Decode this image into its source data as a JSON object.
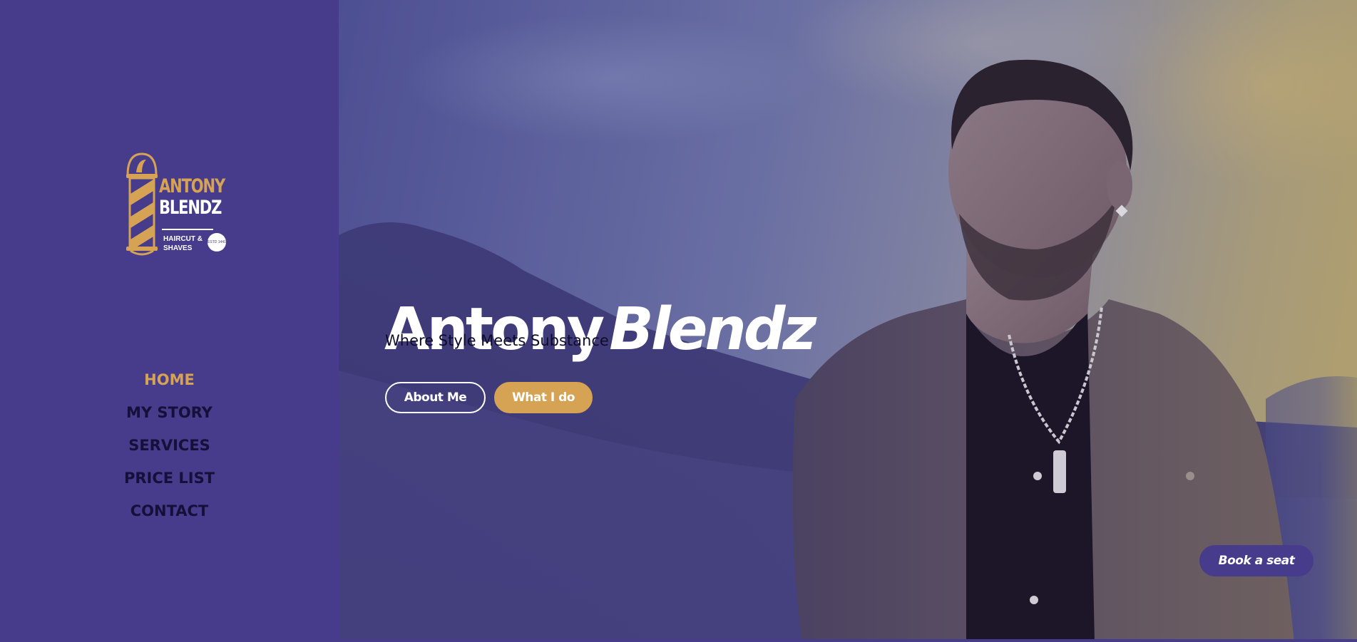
{
  "brand": {
    "name_line1": "ANTONY",
    "name_line2": "BLENDZ",
    "subtitle": "HAIRCUT & SHAVES",
    "badge": "ESTD 1441",
    "colors": {
      "primary": "#473b8c",
      "accent": "#d6a355",
      "text_dark": "#14103a"
    }
  },
  "nav": {
    "items": [
      {
        "label": "HOME",
        "active": true
      },
      {
        "label": "MY STORY",
        "active": false
      },
      {
        "label": "SERVICES",
        "active": false
      },
      {
        "label": "PRICE LIST",
        "active": false
      },
      {
        "label": "CONTACT",
        "active": false
      }
    ]
  },
  "hero": {
    "title_part1": "Antony",
    "title_part2": "Blendz",
    "tagline": "Where Style Meets Substance",
    "about_button": "About Me",
    "what_button": "What I do",
    "book_button": "Book a seat"
  }
}
